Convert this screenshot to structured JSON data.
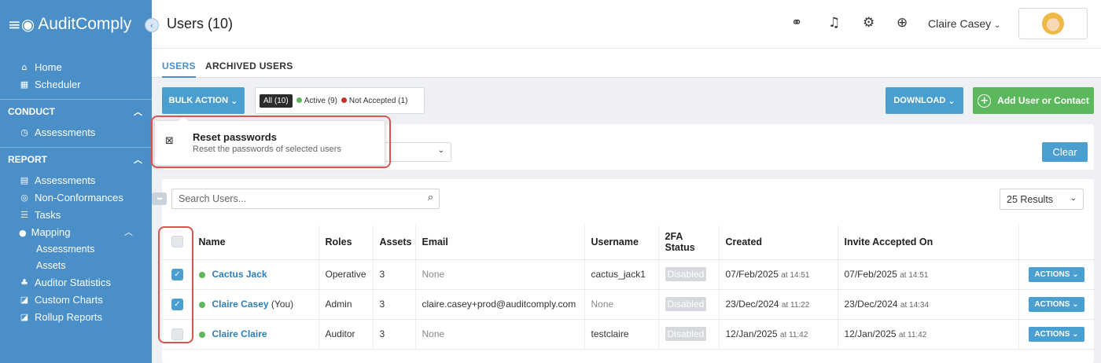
{
  "app": {
    "name": "AuditComply"
  },
  "sidebar": {
    "top_items": [
      {
        "label": "Home",
        "icon": "home-icon"
      },
      {
        "label": "Scheduler",
        "icon": "calendar-icon"
      }
    ],
    "conduct": {
      "title": "CONDUCT",
      "items": [
        {
          "label": "Assessments",
          "icon": "clock-icon"
        }
      ]
    },
    "report": {
      "title": "REPORT",
      "items": [
        {
          "label": "Assessments",
          "icon": "report-icon"
        },
        {
          "label": "Non-Conformances",
          "icon": "search-icon"
        },
        {
          "label": "Tasks",
          "icon": "tasks-icon"
        },
        {
          "label": "Mapping",
          "icon": "pin-icon"
        }
      ],
      "mapping_sub": [
        "Assessments",
        "Assets"
      ],
      "more_items": [
        {
          "label": "Auditor Statistics",
          "icon": "users-icon"
        },
        {
          "label": "Custom Charts",
          "icon": "chart-icon"
        },
        {
          "label": "Rollup Reports",
          "icon": "chart-icon"
        }
      ]
    }
  },
  "header": {
    "title": "Users (10)",
    "user_name": "Claire Casey"
  },
  "tabs": {
    "users": "USERS",
    "archived": "ARCHIVED USERS"
  },
  "toolbar": {
    "bulk_action": "BULK ACTION",
    "filter_all": "All (10)",
    "filter_active": "Active (9)",
    "filter_not_accepted": "Not Accepted (1)",
    "download": "DOWNLOAD",
    "add_user": "Add User or Contact",
    "clear": "Clear"
  },
  "dropdown": {
    "title": "Reset passwords",
    "description": "Reset the passwords of selected users"
  },
  "search": {
    "placeholder": "Search Users..."
  },
  "results": {
    "label": "25 Results"
  },
  "table": {
    "headers": [
      "Name",
      "Roles",
      "Assets",
      "Email",
      "Username",
      "2FA Status",
      "Created",
      "Invite Accepted On"
    ],
    "header_2fa_line1": "2FA",
    "header_2fa_line2": "Status",
    "rows": [
      {
        "name": "Cactus Jack",
        "suffix": "",
        "role": "Operative",
        "assets": "3",
        "email": "None",
        "username": "cactus_jack1",
        "twofa": "Disabled",
        "created_date": "07/Feb/2025",
        "created_time": "at 14:51",
        "accepted_date": "07/Feb/2025",
        "accepted_time": "at 14:51",
        "action": "ACTIONS",
        "checked": true
      },
      {
        "name": "Claire Casey",
        "suffix": " (You)",
        "role": "Admin",
        "assets": "3",
        "email": "claire.casey+prod@auditcomply.com",
        "username": "None",
        "twofa": "Disabled",
        "created_date": "23/Dec/2024",
        "created_time": "at 11:22",
        "accepted_date": "23/Dec/2024",
        "accepted_time": "at 14:34",
        "action": "ACTIONS",
        "checked": true
      },
      {
        "name": "Claire Claire",
        "suffix": "",
        "role": "Auditor",
        "assets": "3",
        "email": "None",
        "username": "testclaire",
        "twofa": "Disabled",
        "created_date": "12/Jan/2025",
        "created_time": "at 11:42",
        "accepted_date": "12/Jan/2025",
        "accepted_time": "at 11:42",
        "action": "ACTIONS",
        "checked": false
      }
    ]
  },
  "colors": {
    "sidebar": "#4a8fc7",
    "primary": "#4a9fd0",
    "success": "#5cb85c",
    "danger": "#d9534f"
  }
}
